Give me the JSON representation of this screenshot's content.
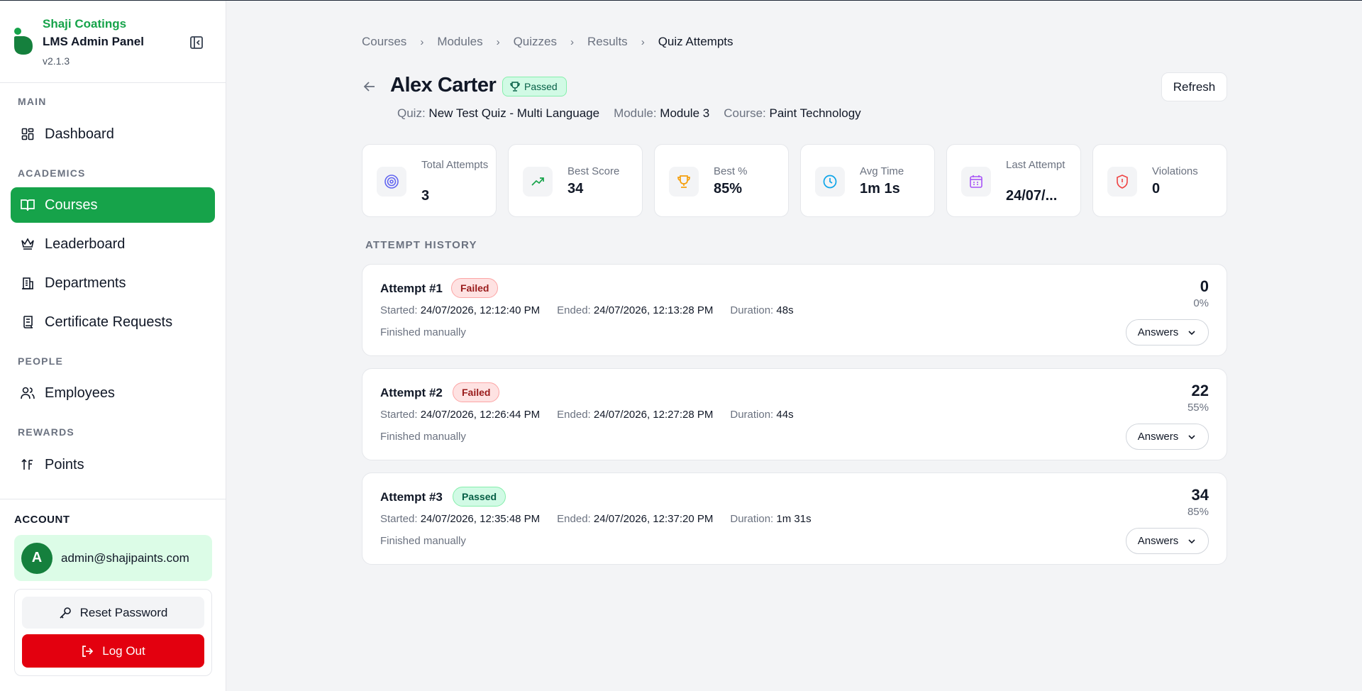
{
  "sidebar": {
    "company": "Shaji Coatings",
    "title": "LMS Admin Panel",
    "version": "v2.1.3",
    "sections": {
      "main": "MAIN",
      "academics": "ACADEMICS",
      "people": "PEOPLE",
      "rewards": "REWARDS"
    },
    "items": {
      "dashboard": "Dashboard",
      "courses": "Courses",
      "leaderboard": "Leaderboard",
      "departments": "Departments",
      "certificate_requests": "Certificate Requests",
      "employees": "Employees",
      "points": "Points"
    },
    "active_item": "courses",
    "account": {
      "label": "ACCOUNT",
      "avatar_initial": "A",
      "email": "admin@shajipaints.com",
      "reset_password": "Reset Password",
      "log_out": "Log Out"
    }
  },
  "breadcrumb": [
    "Courses",
    "Modules",
    "Quizzes",
    "Results",
    "Quiz Attempts"
  ],
  "header": {
    "name": "Alex Carter",
    "status_badge": "Passed",
    "quiz_label": "Quiz:",
    "quiz_value": "New Test Quiz - Multi Language",
    "module_label": "Module:",
    "module_value": "Module 3",
    "course_label": "Course:",
    "course_value": "Paint Technology",
    "refresh": "Refresh"
  },
  "stats": [
    {
      "label": "Total Attempts",
      "value": "3",
      "icon": "target-icon"
    },
    {
      "label": "Best Score",
      "value": "34",
      "icon": "trending-up-icon"
    },
    {
      "label": "Best %",
      "value": "85%",
      "icon": "trophy-icon"
    },
    {
      "label": "Avg Time",
      "value": "1m 1s",
      "icon": "clock-icon"
    },
    {
      "label": "Last Attempt",
      "value": "24/07/...",
      "icon": "calendar-icon"
    },
    {
      "label": "Violations",
      "value": "0",
      "icon": "shield-alert-icon"
    }
  ],
  "history": {
    "label": "ATTEMPT HISTORY",
    "started_label": "Started:",
    "ended_label": "Ended:",
    "duration_label": "Duration:",
    "answers_label": "Answers",
    "attempts": [
      {
        "title": "Attempt #1",
        "status": "Failed",
        "started": "24/07/2026, 12:12:40 PM",
        "ended": "24/07/2026, 12:13:28 PM",
        "duration": "48s",
        "finish": "Finished manually",
        "score": "0",
        "percent": "0%"
      },
      {
        "title": "Attempt #2",
        "status": "Failed",
        "started": "24/07/2026, 12:26:44 PM",
        "ended": "24/07/2026, 12:27:28 PM",
        "duration": "44s",
        "finish": "Finished manually",
        "score": "22",
        "percent": "55%"
      },
      {
        "title": "Attempt #3",
        "status": "Passed",
        "started": "24/07/2026, 12:35:48 PM",
        "ended": "24/07/2026, 12:37:20 PM",
        "duration": "1m 31s",
        "finish": "Finished manually",
        "score": "34",
        "percent": "85%"
      }
    ]
  },
  "colors": {
    "brand_green": "#16a34a",
    "logout_red": "#e3000f",
    "failed_badge": "#fee2e2",
    "passed_badge": "#d1fae5"
  }
}
